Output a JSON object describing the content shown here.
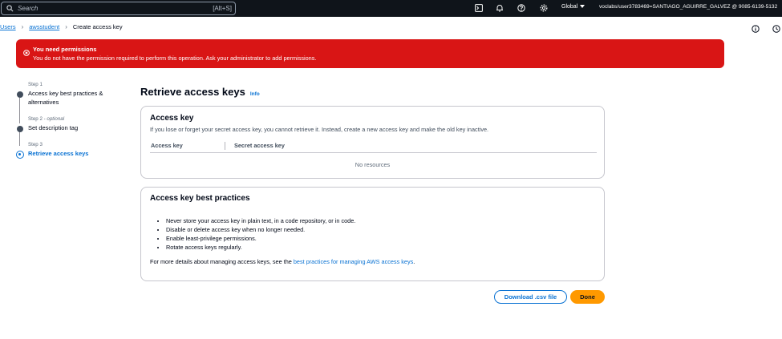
{
  "topnav": {
    "search_placeholder": "Search",
    "search_shortcut": "[Alt+S]",
    "icons": [
      "search-icon",
      "cloudshell-icon",
      "bell-icon",
      "help-icon",
      "gear-icon"
    ],
    "region": "Global",
    "account": "voclabs/user3783469=SANTIAGO_AGUIRRE_GALVEZ @ 9085-6139-5132"
  },
  "breadcrumb": {
    "items": [
      "Users",
      "awsstudent"
    ],
    "current": "Create access key"
  },
  "alert": {
    "title": "You need permissions",
    "message": "You do not have the permission required to perform this operation. Ask your administrator to add permissions.",
    "color": "#d91515"
  },
  "steps": [
    {
      "label": "Step 1",
      "optional": "",
      "title": "Access key best practices & alternatives",
      "state": "done"
    },
    {
      "label": "Step 2 -",
      "optional": "optional",
      "title": "Set description tag",
      "state": "done"
    },
    {
      "label": "Step 3",
      "optional": "",
      "title": "Retrieve access keys",
      "state": "active"
    }
  ],
  "page": {
    "title": "Retrieve access keys",
    "info": "Info"
  },
  "access_key_card": {
    "title": "Access key",
    "description": "If you lose or forget your secret access key, you cannot retrieve it. Instead, create a new access key and make the old key inactive.",
    "columns": [
      "Access key",
      "Secret access key"
    ],
    "empty": "No resources"
  },
  "practices_card": {
    "title": "Access key best practices",
    "bullets": [
      "Never store your access key in plain text, in a code repository, or in code.",
      "Disable or delete access key when no longer needed.",
      "Enable least-privilege permissions.",
      "Rotate access keys regularly."
    ],
    "more_prefix": "For more details about managing access keys, see the ",
    "more_link": "best practices for managing AWS access keys",
    "more_suffix": "."
  },
  "buttons": {
    "download": "Download .csv file",
    "done": "Done"
  },
  "colors": {
    "accent": "#0972d3",
    "primary_button": "#ff9900",
    "nav_bg": "#0f141a"
  }
}
